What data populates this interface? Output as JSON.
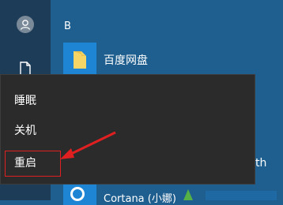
{
  "rail": {
    "avatar_icon": "user-avatar-icon",
    "document_icon": "document-icon"
  },
  "app_list": {
    "section_letter": "B",
    "items": [
      {
        "label": "百度网盘",
        "icon": "folder-icon"
      }
    ],
    "cortana_label": "Cortana (小娜)",
    "partial_text": "th"
  },
  "power_menu": {
    "items": [
      {
        "label": "睡眠"
      },
      {
        "label": "关机"
      },
      {
        "label": "重启"
      }
    ],
    "highlighted_item": "重启"
  },
  "colors": {
    "start_background": "#1f5f8f",
    "rail_background": "#1d3c58",
    "menu_background": "#2b2b2b",
    "tile_blue": "#1e84d4",
    "annotation_red": "#e02020"
  }
}
